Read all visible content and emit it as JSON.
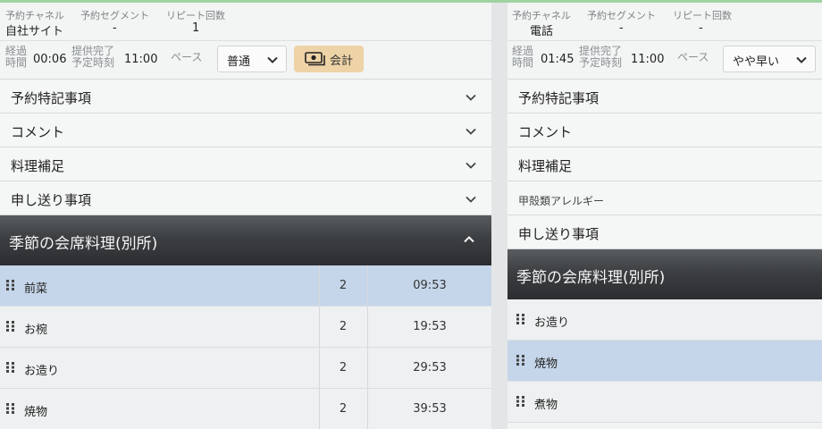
{
  "left": {
    "meta": {
      "channel_label": "予約チャネル",
      "segment_label": "予約セグメント",
      "repeat_label": "リピート回数",
      "channel_value": "自社サイト",
      "segment_value": "-",
      "repeat_value": "1"
    },
    "time": {
      "elapsed_label_1": "経過",
      "elapsed_label_2": "時間",
      "elapsed_value": "00:06",
      "finish_label_1": "提供完了",
      "finish_label_2": "予定時刻",
      "finish_value": "11:00",
      "pace_label": "ペース",
      "pace_value": "普通",
      "checkout_label": "会計"
    },
    "sections": [
      "予約特記事項",
      "コメント",
      "料理補足",
      "申し送り事項"
    ],
    "course_title": "季節の会席料理(別所)",
    "items": [
      {
        "name": "前菜",
        "qty": "2",
        "time": "09:53"
      },
      {
        "name": "お椀",
        "qty": "2",
        "time": "19:53"
      },
      {
        "name": "お造り",
        "qty": "2",
        "time": "29:53"
      },
      {
        "name": "焼物",
        "qty": "2",
        "time": "39:53"
      }
    ]
  },
  "right": {
    "meta": {
      "channel_label": "予約チャネル",
      "segment_label": "予約セグメント",
      "repeat_label": "リピート回数",
      "channel_value": "電話",
      "segment_value": "-",
      "repeat_value": "-"
    },
    "time": {
      "elapsed_label_1": "経過",
      "elapsed_label_2": "時間",
      "elapsed_value": "01:45",
      "finish_label_1": "提供完了",
      "finish_label_2": "予定時刻",
      "finish_value": "11:00",
      "pace_label": "ペース",
      "pace_value": "やや早い"
    },
    "sections": [
      "予約特記事項",
      "コメント",
      "料理補足"
    ],
    "allergy_note": "甲殻類アレルギー",
    "handover_label": "申し送り事項",
    "course_title": "季節の会席料理(別所)",
    "items": [
      {
        "name": "お造り"
      },
      {
        "name": "焼物"
      },
      {
        "name": "煮物"
      }
    ]
  },
  "colors": {
    "accent_checkout": "#eed3a7",
    "selected_row": "#c5d6ea",
    "course_header": "#3c3f42",
    "top_line": "#9fd3a0"
  }
}
